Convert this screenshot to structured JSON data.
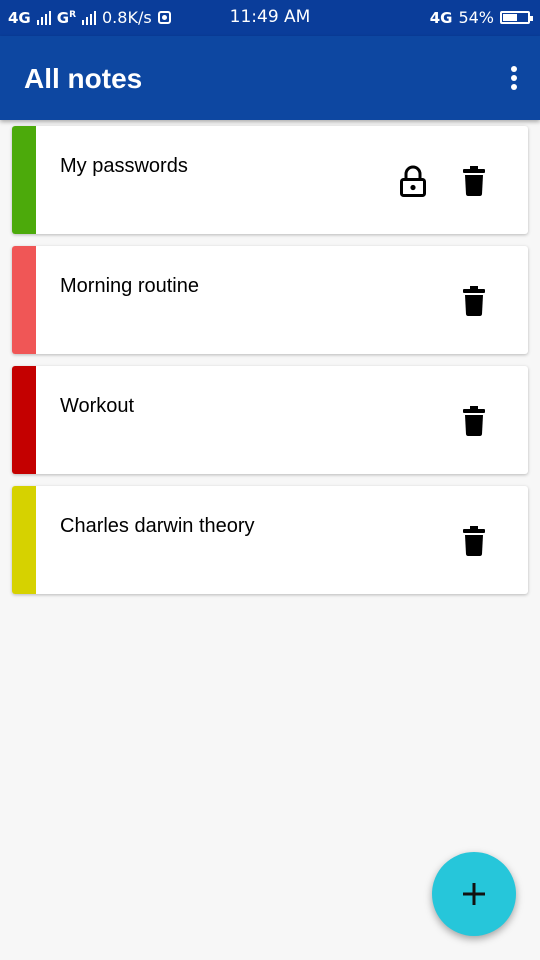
{
  "status_bar": {
    "network_1": "4G",
    "network_2": "G",
    "roaming": "R",
    "speed": "0.8K/s",
    "time": "11:49 AM",
    "network_3": "4G",
    "battery_percent": "54%",
    "battery_level": 0.54
  },
  "app_bar": {
    "title": "All notes",
    "menu_icon": "more-vert-icon"
  },
  "notes": [
    {
      "title": "My passwords",
      "color": "#4caa0b",
      "locked": true
    },
    {
      "title": "Morning routine",
      "color": "#f05656",
      "locked": false
    },
    {
      "title": "Workout",
      "color": "#c40000",
      "locked": false
    },
    {
      "title": "Charles darwin theory",
      "color": "#d6d200",
      "locked": false
    }
  ],
  "fab": {
    "icon": "plus-icon"
  },
  "colors": {
    "status_bar": "#0a3d9a",
    "app_bar": "#0d47a1",
    "fab": "#26c6da",
    "background": "#f7f7f7"
  }
}
